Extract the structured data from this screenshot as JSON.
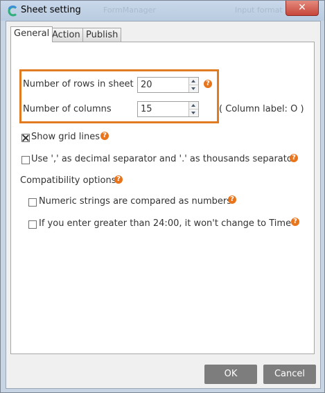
{
  "window": {
    "title": "Sheet setting",
    "close_glyph": "✕",
    "background_titles": [
      "FormManager",
      "Input format"
    ]
  },
  "tabs": [
    {
      "label": "General",
      "active": true
    },
    {
      "label": "Action",
      "active": false
    },
    {
      "label": "Publish",
      "active": false
    }
  ],
  "general": {
    "rows": {
      "label": "Number of rows in sheet",
      "value": "20"
    },
    "columns": {
      "label": "Number of columns",
      "value": "15",
      "hint": "( Column label: O )"
    },
    "show_grid_lines": {
      "label": "Show grid lines",
      "checked": true
    },
    "separator": {
      "label": "Use ',' as decimal separator and '.' as thousands separator",
      "checked": false
    },
    "compat_heading": "Compatibility options",
    "numeric_strings": {
      "label": "Numeric strings are compared as numbers",
      "checked": false
    },
    "time_over_24": {
      "label": "If you enter greater than 24:00, it won't change to Time",
      "checked": false
    },
    "help_glyph": "?"
  },
  "footer": {
    "ok_label": "OK",
    "cancel_label": "Cancel"
  },
  "colors": {
    "accent_orange": "#e07b22",
    "help_icon": "#e8741c",
    "button_gray": "#7d7d7d"
  }
}
